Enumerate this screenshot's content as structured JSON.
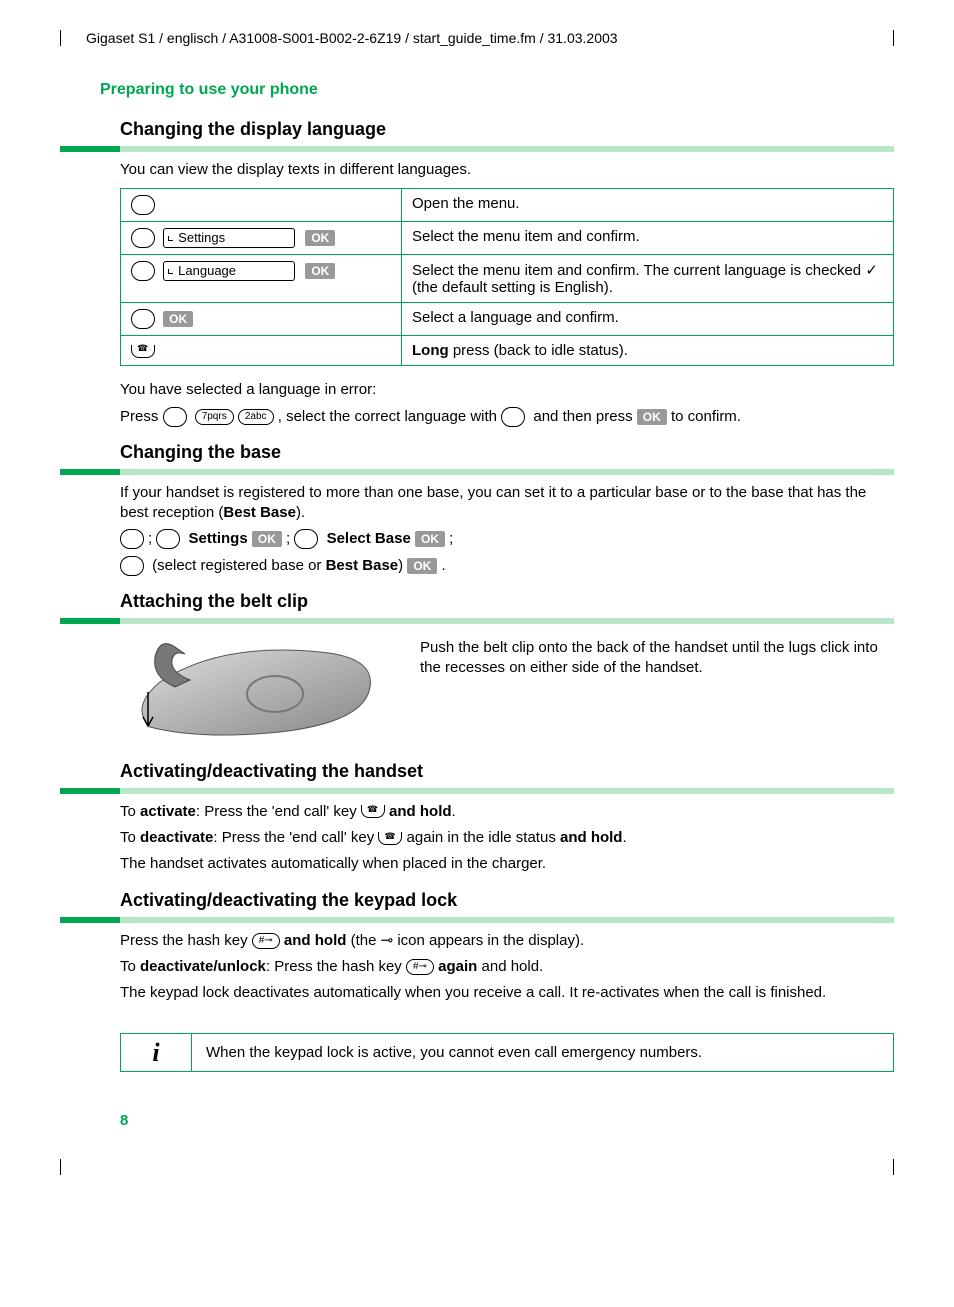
{
  "header": "Gigaset S1 / englisch / A31008-S001-B002-2-6Z19 / start_guide_time.fm / 31.03.2003",
  "section_title": "Preparing to use your phone",
  "h1": "Changing the display language",
  "p1": "You can view the display texts in different languages.",
  "table1": {
    "r1_left_menu": "",
    "r1_right": "Open the menu.",
    "r2_menu": "Settings",
    "r2_right": "Select the menu item and confirm.",
    "r3_menu": "Language",
    "r3_right_a": "Select the menu item and confirm. The current language is checked ",
    "r3_right_b": " (the default setting is English).",
    "r4_right": "Select a language and confirm.",
    "r5_right_a": "Long",
    "r5_right_b": " press (back to idle status)."
  },
  "ok_label": "OK",
  "key7": "7pqrs",
  "key2": "2abc",
  "hash_key": "#⊸",
  "p2": "You have selected a language in error:",
  "p3a": "Press ",
  "p3b": " , select the correct language with ",
  "p3c": " and then press ",
  "p3d": " to confirm.",
  "h2": "Changing the base",
  "p4a": "If your handset is registered to more than one base, you can set it to a particular base or to the base that has the best reception (",
  "p4b": "Best Base",
  "p4c": ").",
  "line1_settings": "Settings",
  "line1_select": "Select Base",
  "p5a": " (select registered base or ",
  "p5b": "Best Base",
  "p5c": ") ",
  "h3": "Attaching the belt clip",
  "belt_text": "Push the belt clip onto the back of the handset until the lugs click into the recesses on either side of the handset.",
  "h4": "Activating/deactivating the handset",
  "p6a": "To ",
  "p6b": "activate",
  "p6c": ": Press the 'end call' key ",
  "p6d": " and hold",
  "p6e": ".",
  "p7a": "To ",
  "p7b": "deactivate",
  "p7c": ": Press the 'end call' key ",
  "p7d": " again in the idle status ",
  "p7e": "and hold",
  "p7f": ".",
  "p8": "The handset activates automatically when placed in the charger.",
  "h5": "Activating/deactivating the keypad lock",
  "p9a": "Press the hash key ",
  "p9b": " and hold",
  "p9c": " (the ",
  "p9d": " icon appears in the display).",
  "p10a": "To ",
  "p10b": "deactivate/unlock",
  "p10c": ": Press the hash key ",
  "p10d": " again",
  "p10e": " and hold.",
  "p11": "The keypad lock deactivates automatically when you receive a call. It re-activates when the call is finished.",
  "note_icon": "i",
  "note_text": "When the keypad lock is active, you cannot even call emergency numbers.",
  "page_num": "8",
  "lock_glyph": "⊸"
}
